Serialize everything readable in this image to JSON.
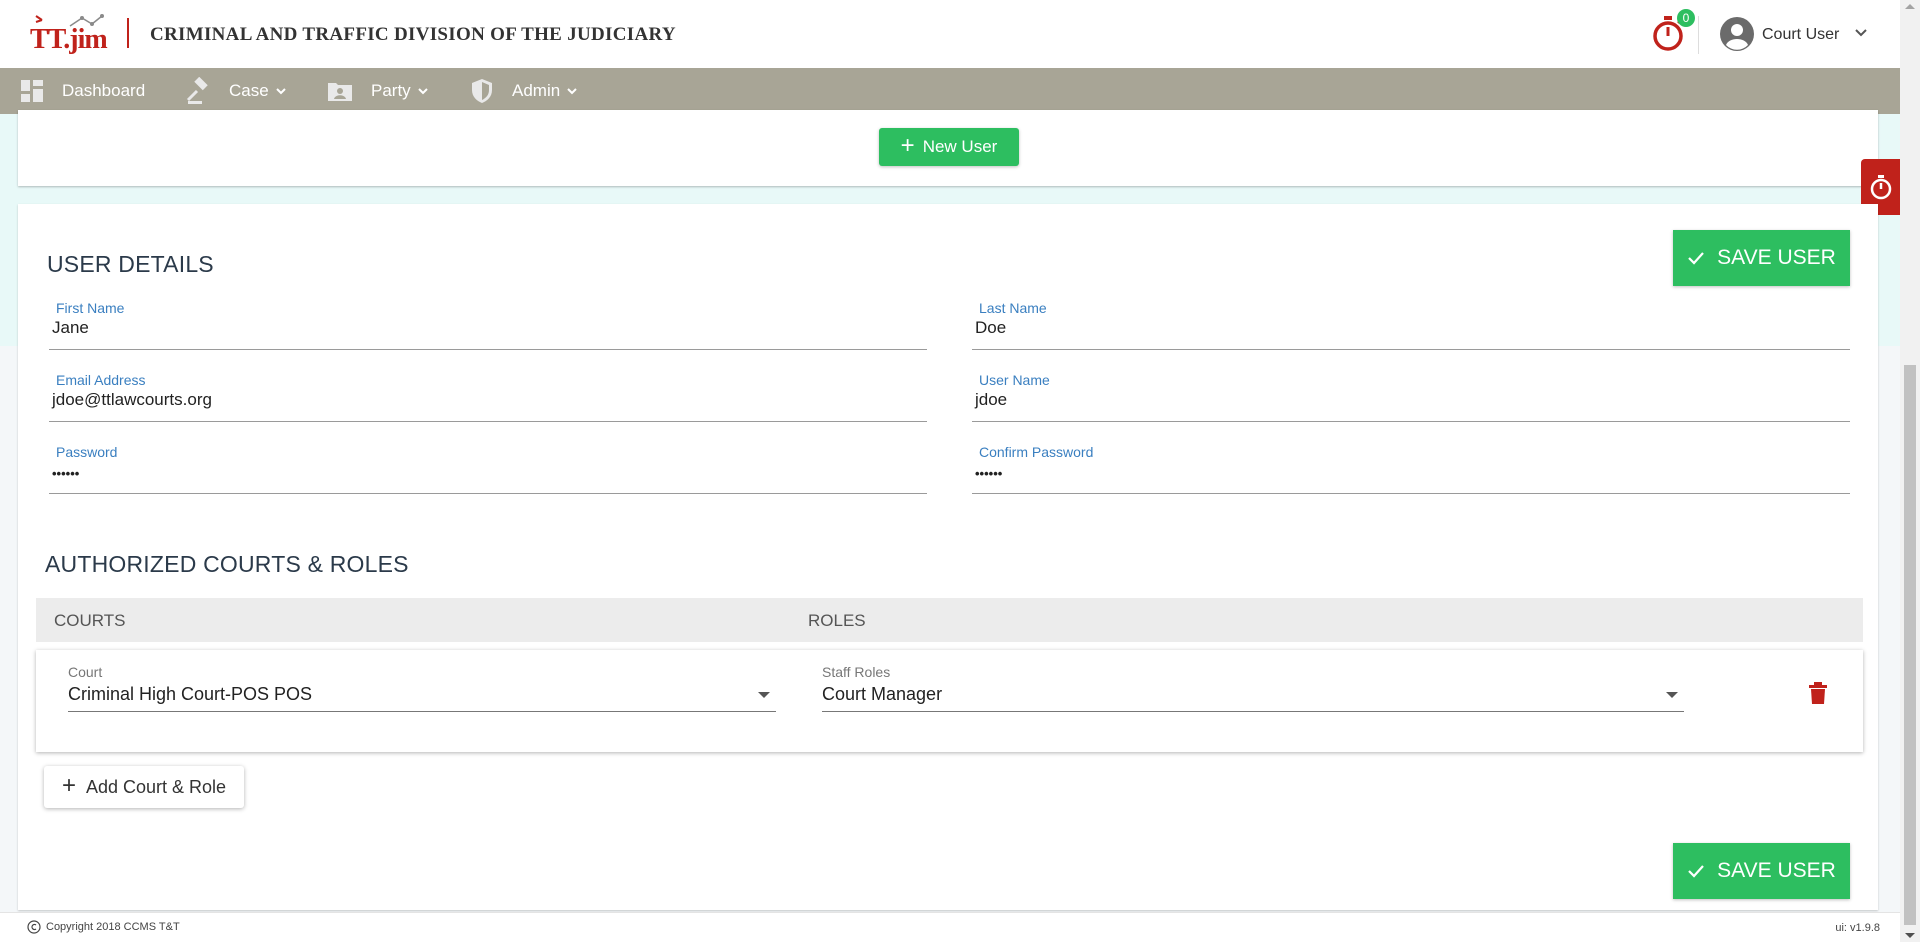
{
  "header": {
    "logo_text": "TT.jim",
    "app_title": "CRIMINAL AND TRAFFIC DIVISION OF THE JUDICIARY",
    "timer_count": "0",
    "user_name": "Court User"
  },
  "nav": {
    "items": [
      {
        "label": "Dashboard",
        "icon": "dashboard-icon"
      },
      {
        "label": "Case",
        "icon": "gavel-icon"
      },
      {
        "label": "Party",
        "icon": "party-folder-icon"
      },
      {
        "label": "Admin",
        "icon": "shield-icon"
      }
    ]
  },
  "toolbar": {
    "new_user_label": "New User"
  },
  "user_details": {
    "title": "USER DETAILS",
    "save_label": "SAVE USER",
    "first_name": {
      "label": "First Name",
      "value": "Jane"
    },
    "last_name": {
      "label": "Last Name",
      "value": "Doe"
    },
    "email": {
      "label": "Email Address",
      "value": "jdoe@ttlawcourts.org"
    },
    "username": {
      "label": "User Name",
      "value": "jdoe"
    },
    "password": {
      "label": "Password",
      "value": "••••••"
    },
    "confirm_password": {
      "label": "Confirm Password",
      "value": "••••••"
    }
  },
  "courts_roles": {
    "title": "AUTHORIZED COURTS & ROLES",
    "columns": [
      "COURTS",
      "ROLES"
    ],
    "rows": [
      {
        "court_label": "Court",
        "court_value": "Criminal High Court-POS POS",
        "role_label": "Staff Roles",
        "role_value": "Court Manager"
      }
    ],
    "add_label": "Add Court & Role",
    "save_label": "SAVE USER"
  },
  "footer": {
    "copyright": "Copyright 2018  CCMS T&T",
    "version": "ui: v1.9.8"
  },
  "colors": {
    "brand_red": "#c0221b",
    "success_green": "#2dbe60",
    "nav_bg": "#a8a596",
    "label_blue": "#3a7fc0"
  }
}
